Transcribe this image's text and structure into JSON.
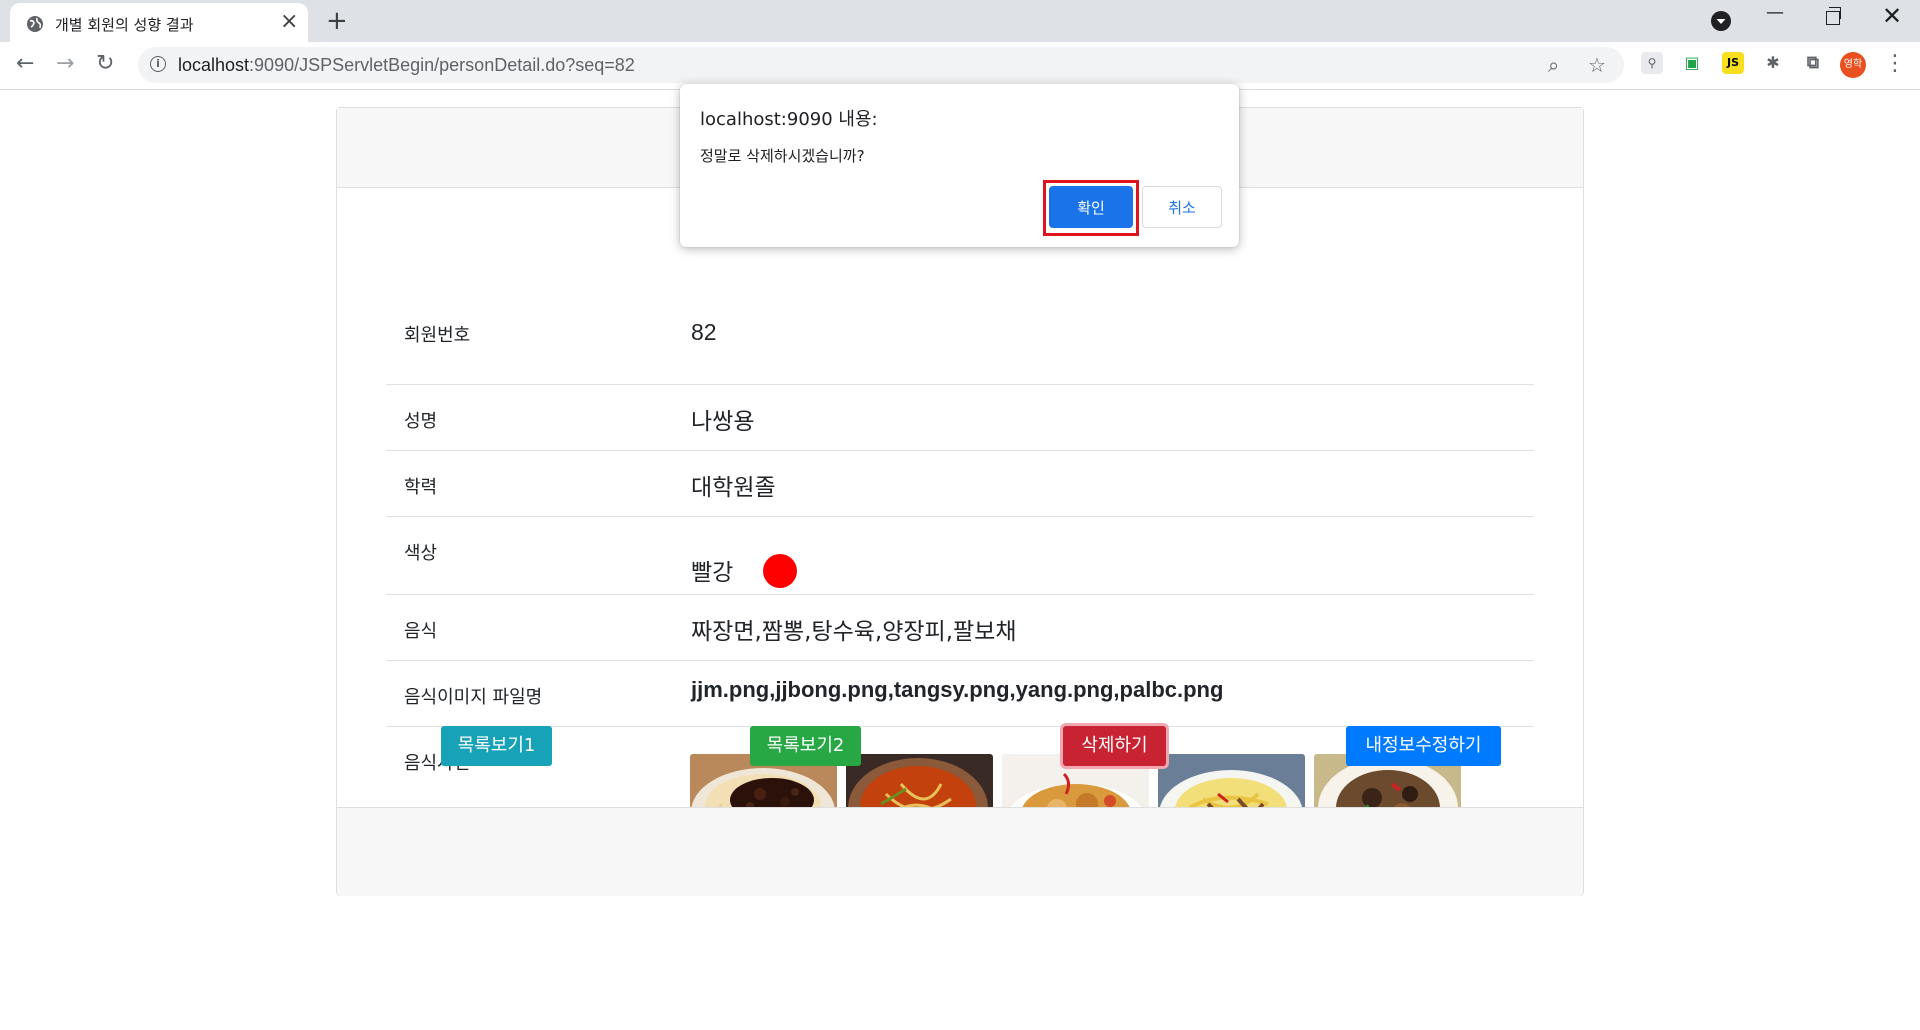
{
  "browser": {
    "tab_title": "개별 회원의 성향 결과",
    "url_host": "localhost",
    "url_rest": ":9090/JSPServletBegin/personDetail.do?seq=82",
    "profile_badge": "영학"
  },
  "dialog": {
    "title": "localhost:9090 내용:",
    "message": "정말로 삭제하시겠습니까?",
    "ok_label": "확인",
    "cancel_label": "취소"
  },
  "detail": {
    "rows": [
      {
        "label": "회원번호",
        "value": "82"
      },
      {
        "label": "성명",
        "value": "나쌍용"
      },
      {
        "label": "학력",
        "value": "대학원졸"
      },
      {
        "label": "색상",
        "value": "빨강"
      },
      {
        "label": "음식",
        "value": "짜장면,짬뽕,탕수육,양장피,팔보채"
      },
      {
        "label": "음식이미지 파일명",
        "value": "jjm.png,jjbong.png,tangsy.png,yang.png,palbc.png"
      },
      {
        "label": "음식사진",
        "value": ""
      }
    ],
    "color_swatch": "#ff0000",
    "food_photos": [
      "jjm.png",
      "jjbong.png",
      "tangsy.png",
      "yang.png",
      "palbc.png"
    ]
  },
  "buttons": {
    "list1": "목록보기1",
    "list2": "목록보기2",
    "delete": "삭제하기",
    "edit": "내정보수정하기"
  },
  "colors": {
    "list1": "#17a2b8",
    "list2": "#28a745",
    "delete": "#c82333",
    "edit": "#007bff",
    "dialog_ok": "#1a73e8"
  }
}
